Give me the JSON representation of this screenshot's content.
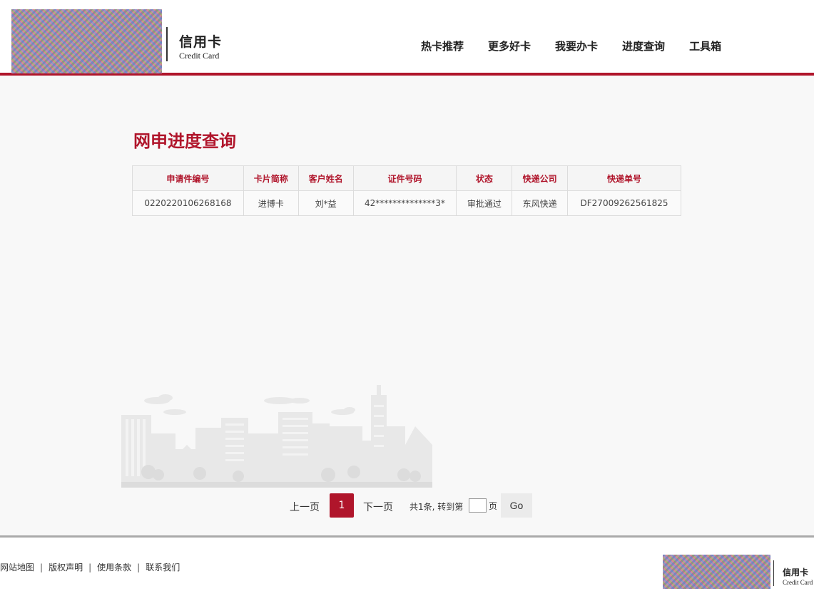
{
  "header": {
    "logo_title": "信用卡",
    "logo_subtitle": "Credit Card",
    "nav": [
      "热卡推荐",
      "更多好卡",
      "我要办卡",
      "进度查询",
      "工具箱"
    ]
  },
  "page_title": "网申进度查询",
  "table": {
    "headers": [
      "申请件编号",
      "卡片简称",
      "客户姓名",
      "证件号码",
      "状态",
      "快递公司",
      "快递单号"
    ],
    "rows": [
      [
        "0220220106268168",
        "进博卡",
        "刘*益",
        "42**************3*",
        "审批通过",
        "东风快递",
        "DF27009262561825"
      ]
    ]
  },
  "pagination": {
    "prev": "上一页",
    "current_page": "1",
    "next": "下一页",
    "total": "共1条, 转到第",
    "jump_value": "",
    "page_unit": "页",
    "go": "Go"
  },
  "footer": {
    "links": [
      "网站地图",
      "版权声明",
      "使用条款",
      "联系我们"
    ],
    "separator": "|",
    "logo_title": "信用卡",
    "logo_subtitle": "Credit Card"
  },
  "colors": {
    "brand_red": "#b0152b",
    "background": "#f8f8f8",
    "illustration_gray": "#e6e6e6"
  }
}
